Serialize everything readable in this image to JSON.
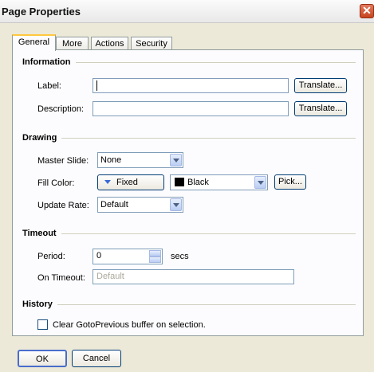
{
  "window": {
    "title": "Page Properties",
    "close_glyph": "✕"
  },
  "tabs": [
    {
      "label": "General"
    },
    {
      "label": "More"
    },
    {
      "label": "Actions"
    },
    {
      "label": "Security"
    }
  ],
  "information": {
    "heading": "Information",
    "label_caption": "Label:",
    "label_value": "",
    "description_caption": "Description:",
    "description_value": "",
    "translate_label": "Translate..."
  },
  "drawing": {
    "heading": "Drawing",
    "master_slide_caption": "Master Slide:",
    "master_slide_value": "None",
    "fill_color_caption": "Fill Color:",
    "fill_mode": "Fixed",
    "fill_color_value": "Black",
    "fill_color_hex": "#000000",
    "pick_label": "Pick...",
    "update_rate_caption": "Update Rate:",
    "update_rate_value": "Default"
  },
  "timeout": {
    "heading": "Timeout",
    "period_caption": "Period:",
    "period_value": "0",
    "secs_label": "secs",
    "on_timeout_caption": "On Timeout:",
    "on_timeout_placeholder": "Default"
  },
  "history": {
    "heading": "History",
    "clear_checkbox_label": "Clear GotoPrevious buffer on selection.",
    "clear_checked": false
  },
  "footer": {
    "ok_label": "OK",
    "cancel_label": "Cancel"
  },
  "colors": {
    "tab_highlight": "#ffc83c",
    "button_border": "#003c74"
  }
}
